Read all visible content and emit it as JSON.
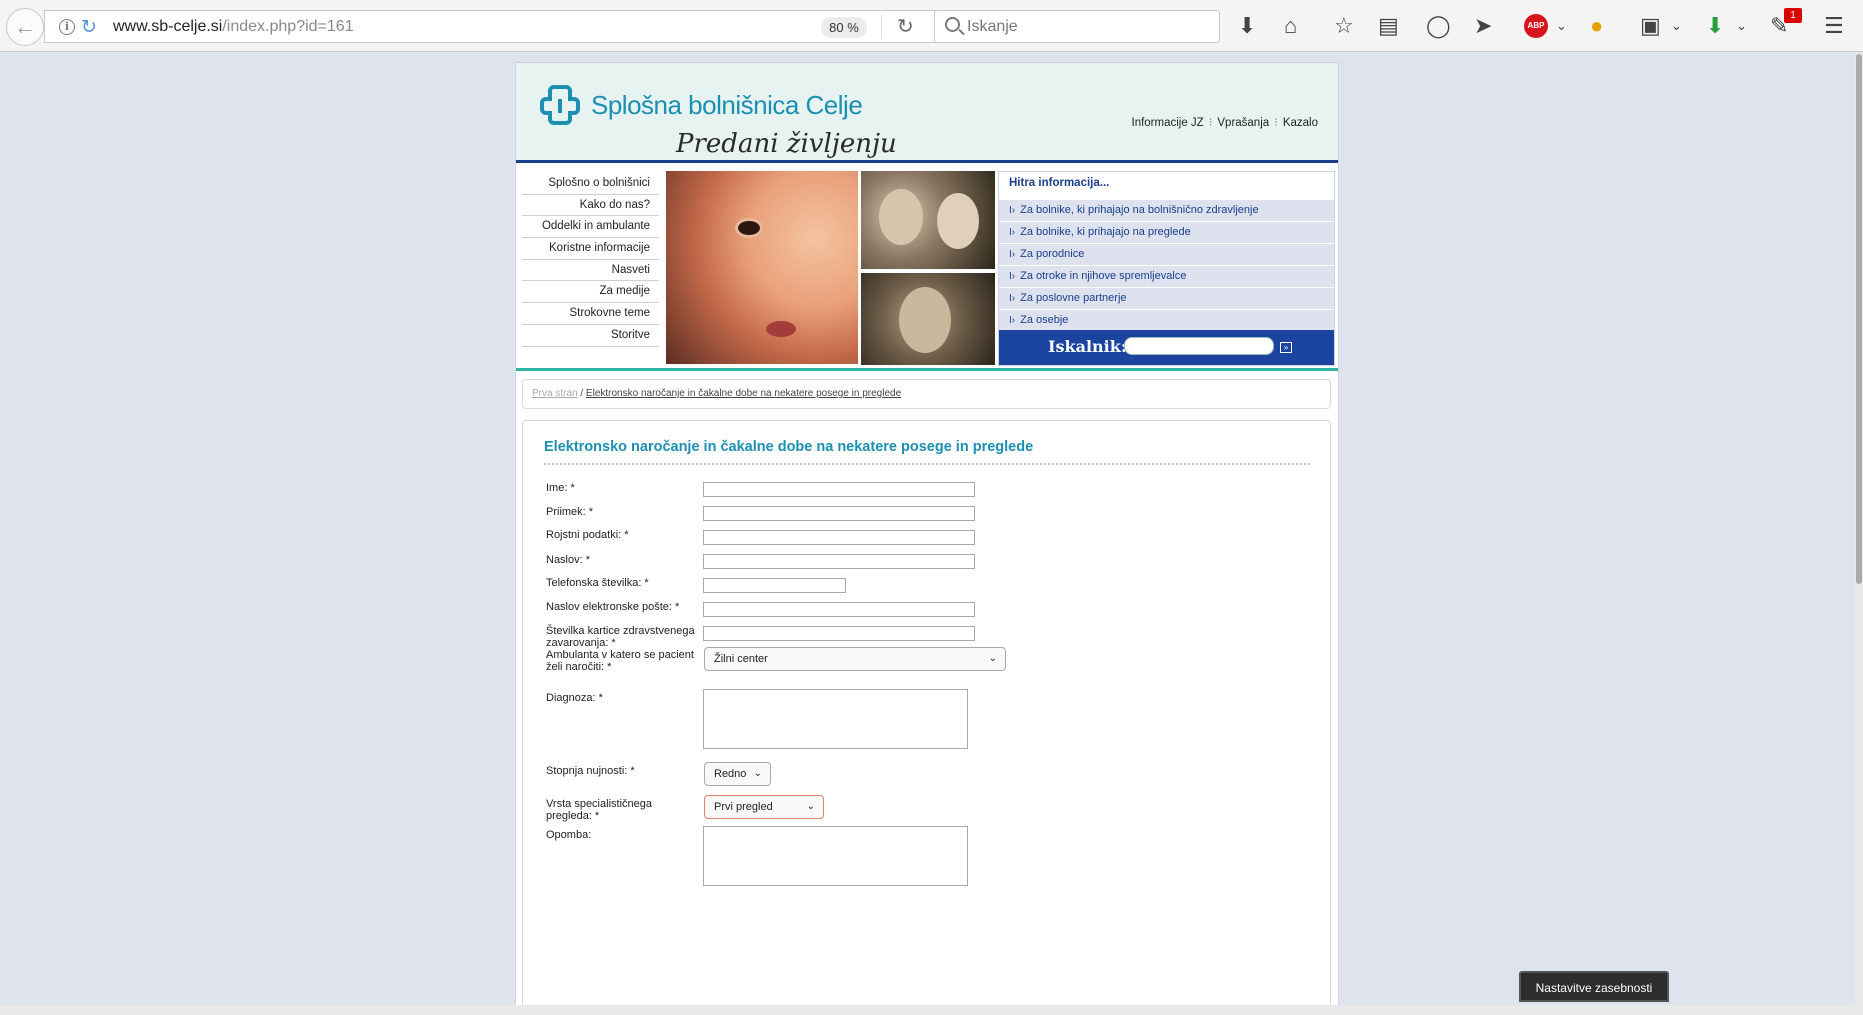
{
  "browser": {
    "url_domain": "www.sb-celje.si",
    "url_path": "/index.php?id=161",
    "zoom": "80 %",
    "search_placeholder": "Iskanje",
    "abp_label": "ABP",
    "notification_count": "1"
  },
  "site": {
    "logo_text": "Splošna bolnišnica Celje",
    "tagline": "Predani življenju",
    "top_nav": [
      "Informacije JZ",
      "Vprašanja",
      "Kazalo"
    ],
    "left_nav": [
      "Splošno o bolnišnici",
      "Kako do nas?",
      "Oddelki in ambulante",
      "Koristne informacije",
      "Nasveti",
      "Za medije",
      "Strokovne teme",
      "Storitve"
    ],
    "quick_info": {
      "title": "Hitra informacija...",
      "items": [
        "Za bolnike, ki prihajajo na bolnišnično zdravljenje",
        "Za bolnike, ki prihajajo na preglede",
        "Za porodnice",
        "Za otroke in njihove spremljevalce",
        "Za poslovne partnerje",
        "Za osebje"
      ],
      "search_label": "Iskalnik:",
      "arrow": "I›"
    }
  },
  "breadcrumb": {
    "home": "Prva stran",
    "separator": "/",
    "current": "Elektronsko naročanje in čakalne dobe na nekatere posege in preglede"
  },
  "form": {
    "title": "Elektronsko naročanje in čakalne dobe na nekatere posege in preglede",
    "labels": {
      "first_name": "Ime: *",
      "last_name": "Priimek: *",
      "birth": "Rojstni podatki: *",
      "address": "Naslov: *",
      "phone": "Telefonska številka: *",
      "email": "Naslov elektronske pošte: *",
      "card": "Številka kartice zdravstvenega zavarovanja: *",
      "clinic": "Ambulanta v katero se pacient želi naročiti: *",
      "diagnosis": "Diagnoza: *",
      "urgency": "Stopnja nujnosti: *",
      "exam_type": "Vrsta specialističnega pregleda: *",
      "note": "Opomba:"
    },
    "values": {
      "clinic": "Žilni center",
      "urgency": "Redno",
      "exam_type": "Prvi pregled"
    }
  },
  "privacy_button": "Nastavitve zasebnosti"
}
